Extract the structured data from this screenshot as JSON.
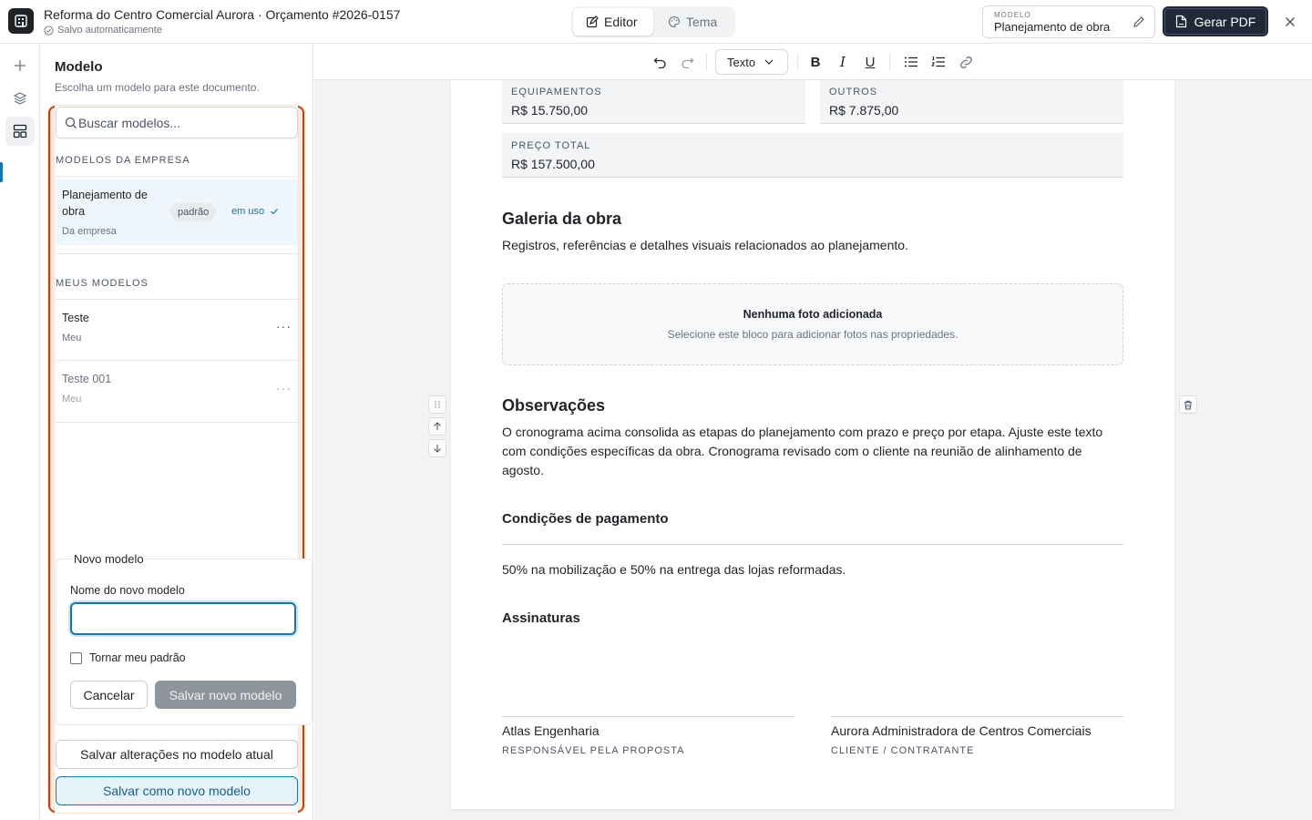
{
  "header": {
    "doc_title": "Reforma do Centro Comercial Aurora · Orçamento #2026-0157",
    "autosave": "Salvo automaticamente",
    "tabs": [
      {
        "label": "Editor"
      },
      {
        "label": "Tema"
      }
    ],
    "model_caption": "MODELO",
    "model_value": "Planejamento de obra",
    "pdf_label": "Gerar PDF"
  },
  "rail": {
    "icons": [
      "plus-icon",
      "layers-icon",
      "template-icon"
    ]
  },
  "panel": {
    "title": "Modelo",
    "subtitle": "Escolha um modelo para este documento.",
    "search_placeholder": "Buscar modelos...",
    "company_section": "MODELOS DA EMPRESA",
    "company_items": [
      {
        "name": "Planejamento de obra",
        "source": "Da empresa",
        "badge": "padrão",
        "status": "em uso"
      }
    ],
    "my_section": "MEUS MODELOS",
    "my_items": [
      {
        "name": "Teste",
        "source": "Meu",
        "menu": "···"
      },
      {
        "name": "Teste 001",
        "source": "Meu",
        "menu": "···"
      }
    ],
    "new_model": {
      "title": "Novo modelo",
      "name_label": "Nome do novo modelo",
      "name_value": "",
      "default_label": "Tornar meu padrão",
      "default_checked": false,
      "cancel_label": "Cancelar",
      "save_label": "Salvar novo modelo"
    },
    "save_changes_label": "Salvar alterações no modelo atual",
    "save_as_label": "Salvar como novo modelo",
    "highlight_color": "#c2410c"
  },
  "toolbar": {
    "block_type": "Texto",
    "bold": "B",
    "italic": "I",
    "underline": "U"
  },
  "document": {
    "fields": [
      {
        "label": "EQUIPAMENTOS",
        "value": "R$ 15.750,00"
      },
      {
        "label": "OUTROS",
        "value": "R$ 7.875,00"
      },
      {
        "label": "PREÇO TOTAL",
        "value": "R$ 157.500,00"
      }
    ],
    "gallery": {
      "title": "Galeria da obra",
      "description": "Registros, referências e detalhes visuais relacionados ao planejamento.",
      "empty_title": "Nenhuma foto adicionada",
      "empty_hint": "Selecione este bloco para adicionar fotos nas propriedades."
    },
    "notes": {
      "title": "Observações",
      "text": "O cronograma acima consolida as etapas do planejamento com prazo e preço por etapa. Ajuste este texto com condições específicas da obra. Cronograma revisado com o cliente na reunião de alinhamento de agosto."
    },
    "payment": {
      "title": "Condições de pagamento",
      "text": "50% na mobilização e 50% na entrega das lojas reformadas."
    },
    "signatures": {
      "title": "Assinaturas",
      "parties": [
        {
          "name": "Atlas Engenharia",
          "role": "RESPONSÁVEL PELA PROPOSTA"
        },
        {
          "name": "Aurora Administradora de Centros Comerciais",
          "role": "CLIENTE / CONTRATANTE"
        }
      ]
    }
  },
  "colors": {
    "accent": "#1877a8",
    "dark_button": "#1f2937"
  }
}
